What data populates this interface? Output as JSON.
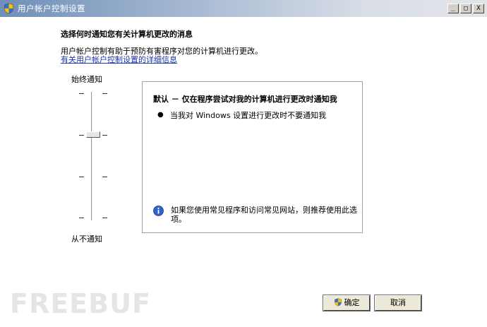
{
  "window": {
    "title": "用户帐户控制设置",
    "controls": {
      "minimize": "_",
      "maximize": "□",
      "close": "X"
    }
  },
  "main": {
    "heading": "选择何时通知您有关计算机更改的消息",
    "description": "用户帐户控制有助于预防有害程序对您的计算机进行更改。",
    "link": "有关用户帐户控制设置的详细信息"
  },
  "slider": {
    "top_label": "始终通知",
    "bottom_label": "从不通知",
    "levels": 4,
    "selected_level": 3
  },
  "info_box": {
    "title": "默认 － 仅在程序尝试对我的计算机进行更改时通知我",
    "bullet": "当我对 Windows 设置进行更改时不要通知我",
    "note": "如果您使用常见程序和访问常见网站，则推荐使用此选项。"
  },
  "buttons": {
    "ok": "确定",
    "cancel": "取消"
  },
  "watermark": "FREEBUF",
  "icons": {
    "title": "uac-shield-icon",
    "info": "info-icon",
    "ok": "uac-shield-icon"
  }
}
